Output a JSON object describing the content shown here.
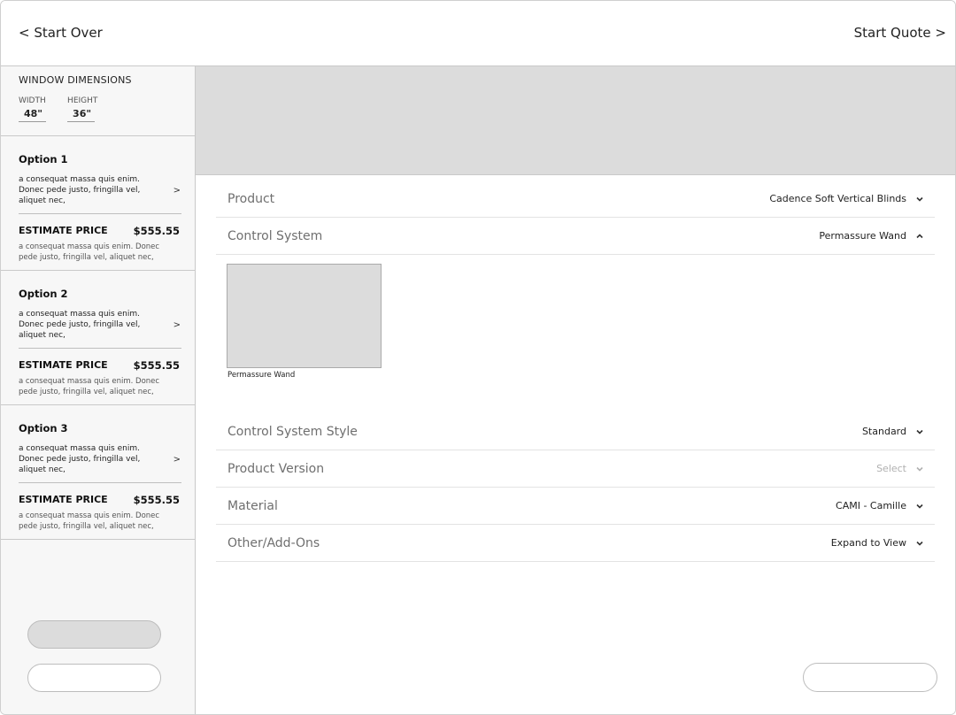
{
  "header": {
    "start_over": "< Start Over",
    "start_quote": "Start Quote >"
  },
  "sidebar": {
    "dimensions": {
      "title": "WINDOW DIMENSIONS",
      "width_label": "WIDTH",
      "width_value": "48\"",
      "height_label": "HEIGHT",
      "height_value": "36\""
    },
    "options": [
      {
        "title": "Option 1",
        "description": "a consequat massa quis enim. Donec pede justo, fringilla vel, aliquet nec,",
        "price_label": "ESTIMATE PRICE",
        "price": "$555.55",
        "price_description": "a consequat massa quis enim. Donec pede justo, fringilla vel, aliquet nec,"
      },
      {
        "title": "Option 2",
        "description": "a consequat massa quis enim. Donec pede justo, fringilla vel, aliquet nec,",
        "price_label": "ESTIMATE PRICE",
        "price": "$555.55",
        "price_description": "a consequat massa quis enim. Donec pede justo, fringilla vel, aliquet nec,"
      },
      {
        "title": "Option 3",
        "description": "a consequat massa quis enim. Donec pede justo, fringilla vel, aliquet nec,",
        "price_label": "ESTIMATE PRICE",
        "price": "$555.55",
        "price_description": "a consequat massa quis enim. Donec pede justo, fringilla vel, aliquet nec,"
      }
    ],
    "chevron_glyph": ">"
  },
  "main": {
    "rows": [
      {
        "label": "Product",
        "value": "Cadence Soft Vertical Blinds",
        "icon": "chevron-down-icon"
      },
      {
        "label": "Control System",
        "value": "Permassure Wand",
        "icon": "chevron-up-icon"
      },
      {
        "label": "Control System Style",
        "value": "Standard",
        "icon": "chevron-down-icon"
      },
      {
        "label": "Product Version",
        "value": "Select",
        "icon": "chevron-down-icon"
      },
      {
        "label": "Material",
        "value": "CAMI - Camille",
        "icon": "chevron-down-icon"
      },
      {
        "label": "Other/Add-Ons",
        "value": "Expand to View",
        "icon": "chevron-down-icon"
      }
    ],
    "swatch_label": "Permassure Wand"
  },
  "colors": {
    "placeholder_gray": "#dcdcdc",
    "border": "#c9c9c9",
    "sidebar_bg": "#f7f7f7",
    "muted_text": "#b0b0b0"
  }
}
